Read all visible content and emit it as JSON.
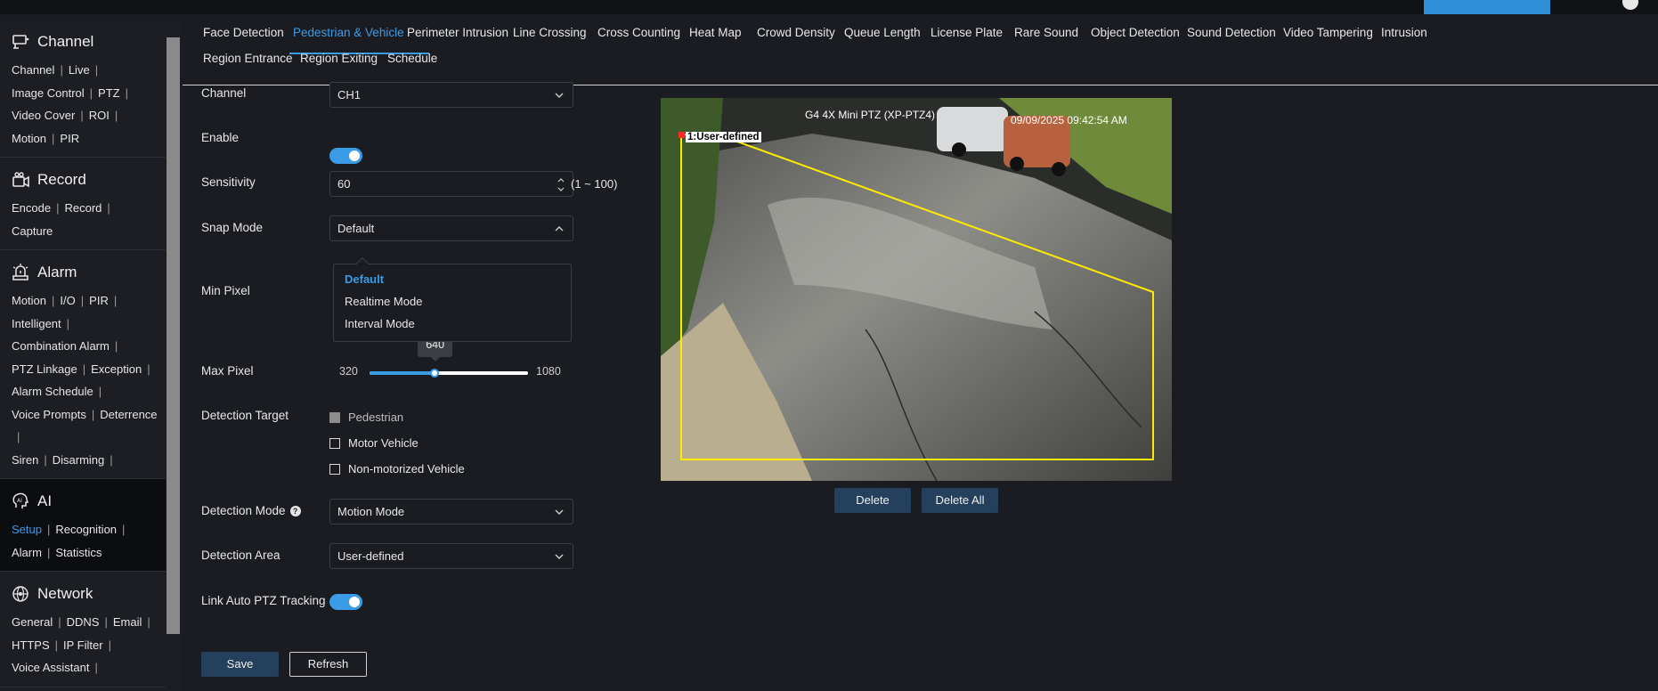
{
  "sidebar": {
    "sections": [
      {
        "title": "Channel",
        "icon": "channel-icon",
        "links": [
          "Channel",
          "Live",
          "Image Control",
          "PTZ",
          "Video Cover",
          "ROI",
          "Motion",
          "PIR"
        ]
      },
      {
        "title": "Record",
        "icon": "record-icon",
        "links": [
          "Encode",
          "Record",
          "Capture"
        ]
      },
      {
        "title": "Alarm",
        "icon": "alarm-icon",
        "links": [
          "Motion",
          "I/O",
          "PIR",
          "Intelligent",
          "Combination Alarm",
          "PTZ Linkage",
          "Exception",
          "Alarm Schedule",
          "Voice Prompts",
          "Deterrence",
          "Siren",
          "Disarming"
        ]
      },
      {
        "title": "AI",
        "icon": "ai-icon",
        "active_link": "Setup",
        "links": [
          "Setup",
          "Recognition",
          "Alarm",
          "Statistics"
        ]
      },
      {
        "title": "Network",
        "icon": "network-icon",
        "links": [
          "General",
          "DDNS",
          "Email",
          "HTTPS",
          "IP Filter",
          "Voice Assistant"
        ]
      }
    ]
  },
  "tabs": {
    "row1": [
      "Face Detection",
      "Pedestrian & Vehicle",
      "Perimeter Intrusion",
      "Line Crossing",
      "Cross Counting",
      "Heat Map",
      "Crowd Density",
      "Queue Length",
      "License Plate",
      "Rare Sound",
      "Object Detection",
      "Sound Detection",
      "Video Tampering",
      "Intrusion"
    ],
    "row2": [
      "Region Entrance",
      "Region Exiting",
      "Schedule"
    ],
    "active": "Pedestrian & Vehicle"
  },
  "form": {
    "channel": {
      "label": "Channel",
      "value": "CH1"
    },
    "enable": {
      "label": "Enable",
      "on": true
    },
    "sensitivity": {
      "label": "Sensitivity",
      "value": "60",
      "range": "(1 ~ 100)"
    },
    "snap_mode": {
      "label": "Snap Mode",
      "value": "Default",
      "options": [
        "Default",
        "Realtime Mode",
        "Interval Mode"
      ],
      "selected": "Default"
    },
    "min_pixel": {
      "label": "Min Pixel"
    },
    "max_pixel": {
      "label": "Max Pixel",
      "min": "320",
      "max": "1080",
      "value": "640",
      "fraction": 0.4167
    },
    "detection_target": {
      "label": "Detection Target",
      "options": [
        {
          "label": "Pedestrian",
          "checked": false,
          "disabled": true
        },
        {
          "label": "Motor Vehicle",
          "checked": false,
          "disabled": false
        },
        {
          "label": "Non-motorized Vehicle",
          "checked": false,
          "disabled": false
        }
      ]
    },
    "detection_mode": {
      "label": "Detection Mode",
      "value": "Motion Mode",
      "help": "?"
    },
    "detection_area": {
      "label": "Detection Area",
      "value": "User-defined"
    },
    "link_auto_ptz": {
      "label": "Link Auto PTZ Tracking",
      "on": true
    },
    "save_label": "Save",
    "refresh_label": "Refresh"
  },
  "video": {
    "camera_name": "G4 4X Mini PTZ (XP-PTZ4)",
    "timestamp": "09/09/2025 09:42:54 AM",
    "region_label": "1:User-defined",
    "region_color": "#ffeb00",
    "delete_label": "Delete",
    "delete_all_label": "Delete All"
  },
  "colors": {
    "accent": "#3a9be6",
    "background": "#1a1c21",
    "button_primary": "#24405c"
  }
}
